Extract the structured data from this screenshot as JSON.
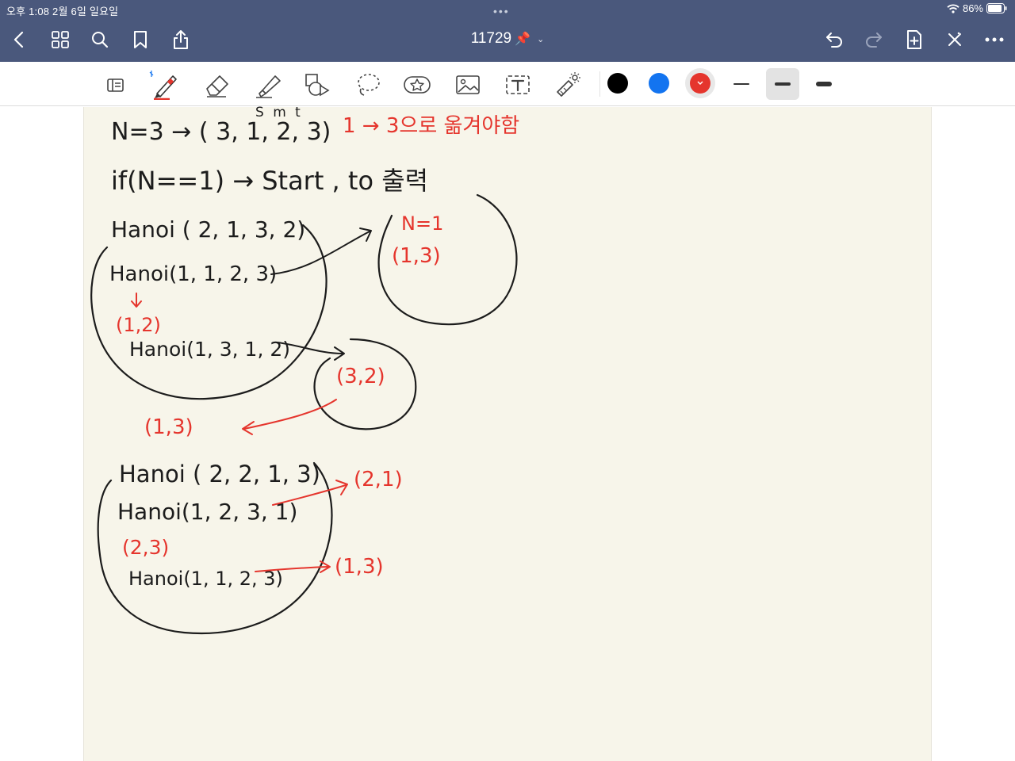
{
  "status_bar": {
    "time_date": "오후 1:08   2월 6일 일요일",
    "dots": "•••",
    "battery": "86%"
  },
  "nav_bar": {
    "title": "11729",
    "title_pin": "📌",
    "title_chevron": "⌄",
    "icons": [
      "back-icon",
      "grid-icon",
      "search-icon",
      "bookmark-icon",
      "share-icon",
      "undo-icon",
      "redo-icon",
      "add-page-icon",
      "close-x-icon",
      "more-icon"
    ]
  },
  "toolbar": {
    "tools": [
      "read-mode-icon",
      "pen-icon",
      "eraser-icon",
      "highlighter-icon",
      "shapes-icon",
      "lasso-icon",
      "sticker-icon",
      "image-icon",
      "text-icon",
      "laser-pointer-icon"
    ],
    "active_tool": "pen-icon",
    "colors": [
      "#000000",
      "#1374f0",
      "#e5352d"
    ],
    "selected_color": "#e5352d",
    "stroke_widths": [
      "thin",
      "medium",
      "thick"
    ],
    "selected_stroke": "medium"
  },
  "note": {
    "line1": "N=3 → ( 3, 1, 2, 3)",
    "line1_smt": "S m t",
    "line1_red": "1 → 3으로 옮겨야함",
    "line2": "if(N==1) → Start , to 출력",
    "block1": {
      "call": "Hanoi ( 2, 1, 3, 2)",
      "sub1": "Hanoi(1, 1, 2, 3)",
      "sub1_move": "(1,2)",
      "sub2": "Hanoi(1, 3, 1, 2)",
      "circle1_label": "N=1",
      "circle1_move": "(1,3)",
      "circle2_move": "(3,2)",
      "return_move": "(1,3)"
    },
    "block2": {
      "call": "Hanoi ( 2, 2, 1, 3)",
      "sub1": "Hanoi(1, 2, 3, 1)",
      "sub1_move": "(2,1)",
      "middle_move": "(2,3)",
      "sub2": "Hanoi(1, 1, 2, 3)",
      "sub2_move": "(1,3)"
    }
  }
}
